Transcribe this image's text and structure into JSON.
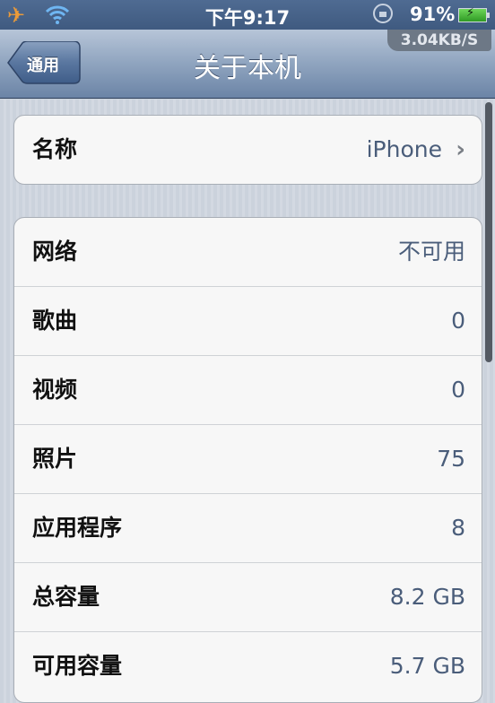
{
  "status_bar": {
    "airplane_icon": "airplane-icon",
    "wifi_icon": "wifi-icon",
    "time": "下午9:17",
    "rotation_lock_icon": "rotation-lock-icon",
    "battery_percent": "91%",
    "battery_icon": "battery-charging-icon",
    "network_speed": "3.04KB/S"
  },
  "nav": {
    "back_label": "通用",
    "title": "关于本机"
  },
  "groups": [
    {
      "rows": [
        {
          "label": "名称",
          "value": "iPhone",
          "chevron": "›"
        }
      ]
    },
    {
      "rows": [
        {
          "label": "网络",
          "value": "不可用"
        },
        {
          "label": "歌曲",
          "value": "0"
        },
        {
          "label": "视频",
          "value": "0"
        },
        {
          "label": "照片",
          "value": "75"
        },
        {
          "label": "应用程序",
          "value": "8"
        },
        {
          "label": "总容量",
          "value": "8.2 GB"
        },
        {
          "label": "可用容量",
          "value": "5.7 GB"
        }
      ]
    }
  ]
}
